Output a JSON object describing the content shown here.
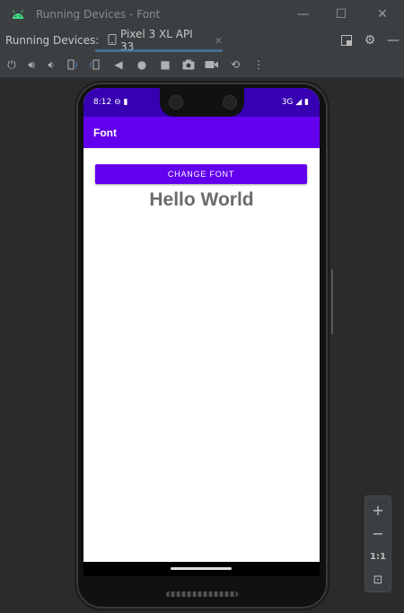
{
  "window": {
    "title": "Running Devices - Font",
    "controls": {
      "minimize": "—",
      "maximize": "☐",
      "close": "✕"
    }
  },
  "tabs": {
    "label": "Running Devices:",
    "active_tab": "Pixel 3 XL API 33",
    "close_glyph": "✕"
  },
  "toolbar": {
    "icons": [
      "power-icon",
      "volume-up-icon",
      "volume-down-icon",
      "rotate-left-icon",
      "rotate-right-icon",
      "fold-icon",
      "back-icon",
      "home-icon",
      "overview-icon",
      "screenshot-icon",
      "screen-record-icon",
      "snapshot-icon",
      "more-icon"
    ]
  },
  "device": {
    "status_time": "8:12",
    "status_network": "3G",
    "app_title": "Font",
    "button_label": "CHANGE FONT",
    "hello_text": "Hello World"
  },
  "zoom": {
    "in": "+",
    "out": "−",
    "actual": "1:1",
    "fit": "⊡"
  },
  "colors": {
    "accent": "#6200ee",
    "status_bar": "#3700b3",
    "ide_bg": "#2b2b2b"
  }
}
